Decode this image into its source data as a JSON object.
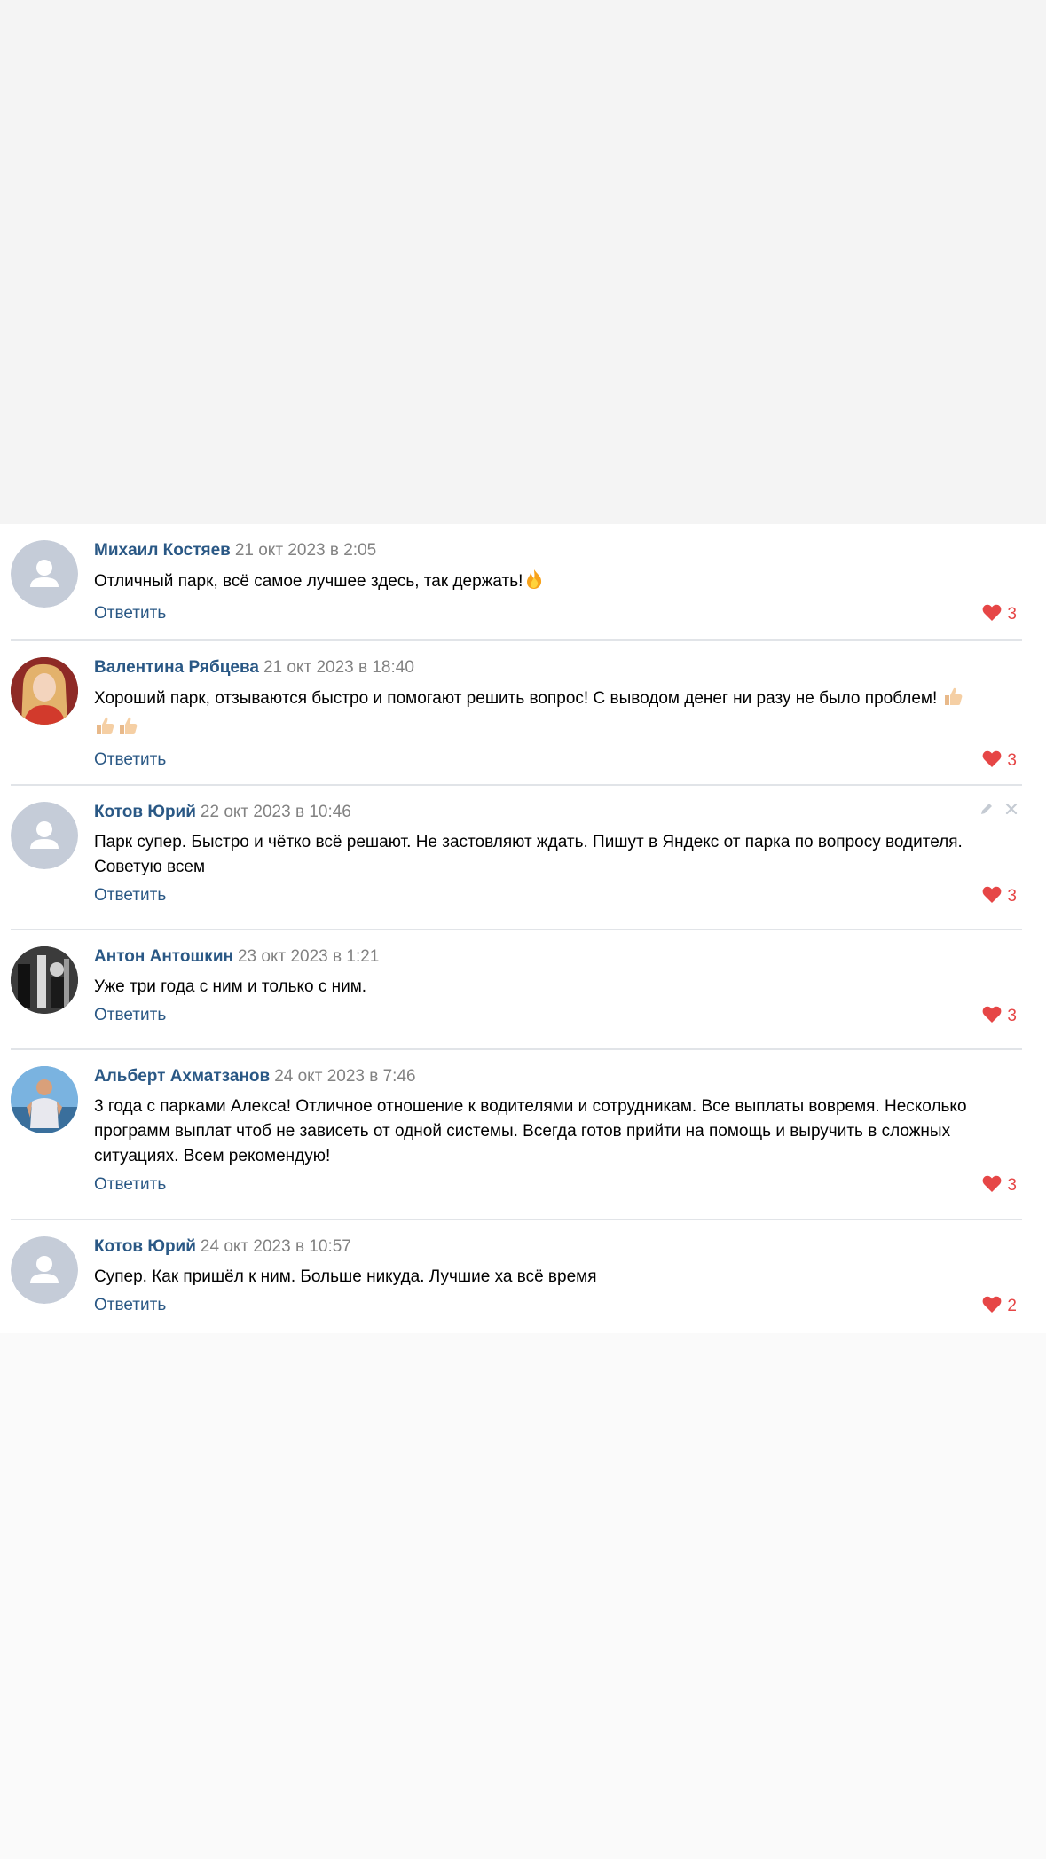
{
  "comments": [
    {
      "author": "Михаил Костяев",
      "date": "21 окт 2023 в 2:05",
      "text": "Отличный парк, всё самое лучшее здесь, так держать!",
      "emojis": [
        "fire-emoji"
      ],
      "reply_label": "Ответить",
      "likes": "3",
      "avatar": "default-avatar-icon"
    },
    {
      "author": "Валентина Рябцева",
      "date": "21 окт 2023 в 18:40",
      "text": "Хороший парк, отзываются быстро и помогают решить вопрос! С выводом денег ни разу не было проблем!",
      "emojis": [
        "thumbs-up-emoji",
        "thumbs-up-emoji",
        "thumbs-up-emoji"
      ],
      "reply_label": "Ответить",
      "likes": "3",
      "avatar": "user-photo-avatar"
    },
    {
      "author": "Котов Юрий",
      "date": "22 окт 2023 в 10:46",
      "text": "Парк супер. Быстро и чётко всё решают. Не застовляют ждать. Пишут в Яндекс от парка по вопросу водителя. Советую всем",
      "reply_label": "Ответить",
      "likes": "3",
      "avatar": "default-avatar-icon",
      "actions": [
        "edit-icon",
        "delete-icon"
      ]
    },
    {
      "author": "Антон Антошкин",
      "date": "23 окт 2023 в 1:21",
      "text": "Уже три года с ним и только с ним.",
      "reply_label": "Ответить",
      "likes": "3",
      "avatar": "user-photo-avatar"
    },
    {
      "author": "Альберт Ахматзанов",
      "date": "24 окт 2023 в 7:46",
      "text": "3 года с парками Алекса! Отличное отношение к водителями и сотрудникам. Все выплаты вовремя. Несколько программ выплат чтоб не зависеть от одной системы. Всегда готов прийти на помощь и выручить в сложных ситуациях. Всем рекомендую!",
      "reply_label": "Ответить",
      "likes": "3",
      "avatar": "user-photo-avatar"
    },
    {
      "author": "Котов Юрий",
      "date": "24 окт 2023 в 10:57",
      "text": "Супер. Как пришёл к ним. Больше никуда. Лучшие ха всё время",
      "reply_label": "Ответить",
      "likes": "2",
      "avatar": "default-avatar-icon"
    }
  ],
  "colors": {
    "author": "#2a5885",
    "date": "#828282",
    "like": "#e64646",
    "divider": "#e1e4e8",
    "avatar_default": "#c5ccd8"
  }
}
